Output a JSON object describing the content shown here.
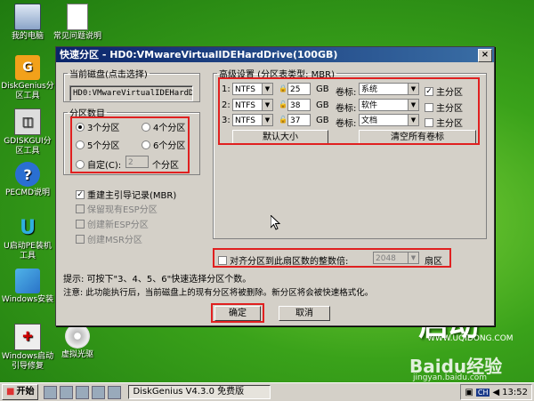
{
  "desktop": {
    "icons": [
      {
        "label": "我的电脑"
      },
      {
        "label": "常见问题说明"
      },
      {
        "label": "DiskGenius分区工具"
      },
      {
        "label": "GDISKGUI分区工具"
      },
      {
        "label": "PECMD说明"
      },
      {
        "label": "U启动PE装机工具"
      },
      {
        "label": "Windows安装"
      },
      {
        "label": "Windows启动引导修复"
      },
      {
        "label": "虚拟光驱"
      }
    ],
    "brand": "启动",
    "brand_url": "WWW.UQIDONG.COM",
    "watermark": "Baidu经验",
    "watermark_url": "jingyan.baidu.com"
  },
  "dialog": {
    "title": "快速分区 - HD0:VMwareVirtualIDEHardDrive(100GB)",
    "close": "×",
    "disk_group": {
      "legend": "当前磁盘(点击选择)",
      "value": "HD0:VMwareVirtualIDEHardDri"
    },
    "count_group": {
      "legend": "分区数目",
      "options": [
        "3个分区",
        "4个分区",
        "5个分区",
        "6个分区"
      ],
      "custom_label": "自定(C):",
      "custom_value": "2",
      "custom_unit": "个分区"
    },
    "options": {
      "rebuild_mbr": "重建主引导记录(MBR)",
      "keep_esp": "保留现有ESP分区",
      "create_esp": "创建新ESP分区",
      "create_msr": "创建MSR分区"
    },
    "advanced": {
      "legend": "高级设置 (分区表类型: MBR)",
      "rows": [
        {
          "idx": "1:",
          "fs": "NTFS",
          "size": "25",
          "unit": "GB",
          "label_caption": "卷标:",
          "label": "系统",
          "primary": "主分区",
          "primary_checked": true
        },
        {
          "idx": "2:",
          "fs": "NTFS",
          "size": "38",
          "unit": "GB",
          "label_caption": "卷标:",
          "label": "软件",
          "primary": "主分区",
          "primary_checked": false
        },
        {
          "idx": "3:",
          "fs": "NTFS",
          "size": "37",
          "unit": "GB",
          "label_caption": "卷标:",
          "label": "文档",
          "primary": "主分区",
          "primary_checked": false
        }
      ],
      "default_size": "默认大小",
      "clear_labels": "清空所有卷标"
    },
    "align": {
      "label": "对齐分区到此扇区数的整数倍:",
      "value": "2048",
      "unit": "扇区"
    },
    "tip": "提示: 可按下\"3、4、5、6\"快速选择分区个数。",
    "note": "注意: 此功能执行后，当前磁盘上的现有分区将被删除。新分区将会被快速格式化。",
    "ok": "确定",
    "cancel": "取消"
  },
  "taskbar": {
    "start": "开始",
    "task": "DiskGenius V4.3.0 免费版",
    "ime": "CH",
    "clock": "13:52"
  },
  "colors": {
    "highlight": "#e02020",
    "title_bar": "#0a246a"
  }
}
